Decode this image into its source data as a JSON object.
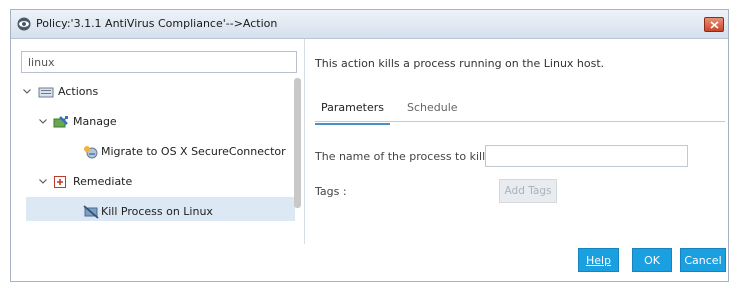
{
  "window": {
    "title": "Policy:'3.1.1 AntiVirus Compliance'-->Action",
    "close_icon": "close-icon"
  },
  "search": {
    "value": "linux"
  },
  "tree": {
    "actions": {
      "label": "Actions",
      "icon": "folder-icon"
    },
    "manage": {
      "label": "Manage",
      "icon": "manage-icon"
    },
    "migrate": {
      "label": "Migrate to OS X SecureConnector",
      "icon": "secureconnector-icon"
    },
    "remediate": {
      "label": "Remediate",
      "icon": "remediate-plus-icon"
    },
    "kill": {
      "label": "Kill Process on Linux",
      "icon": "kill-process-icon"
    }
  },
  "detail": {
    "description": "This action kills a process running on the Linux host.",
    "tabs": [
      {
        "label": "Parameters",
        "active": true
      },
      {
        "label": "Schedule",
        "active": false
      }
    ],
    "process_label": "The name of the process to kill",
    "process_value": "",
    "tags_label": "Tags :",
    "add_tags_label": "Add Tags"
  },
  "footer": {
    "help_label": "Help",
    "ok_label": "OK",
    "cancel_label": "Cancel"
  },
  "colors": {
    "accent": "#1a9fe0",
    "selection": "#dce8f4",
    "close": "#c9462a"
  }
}
